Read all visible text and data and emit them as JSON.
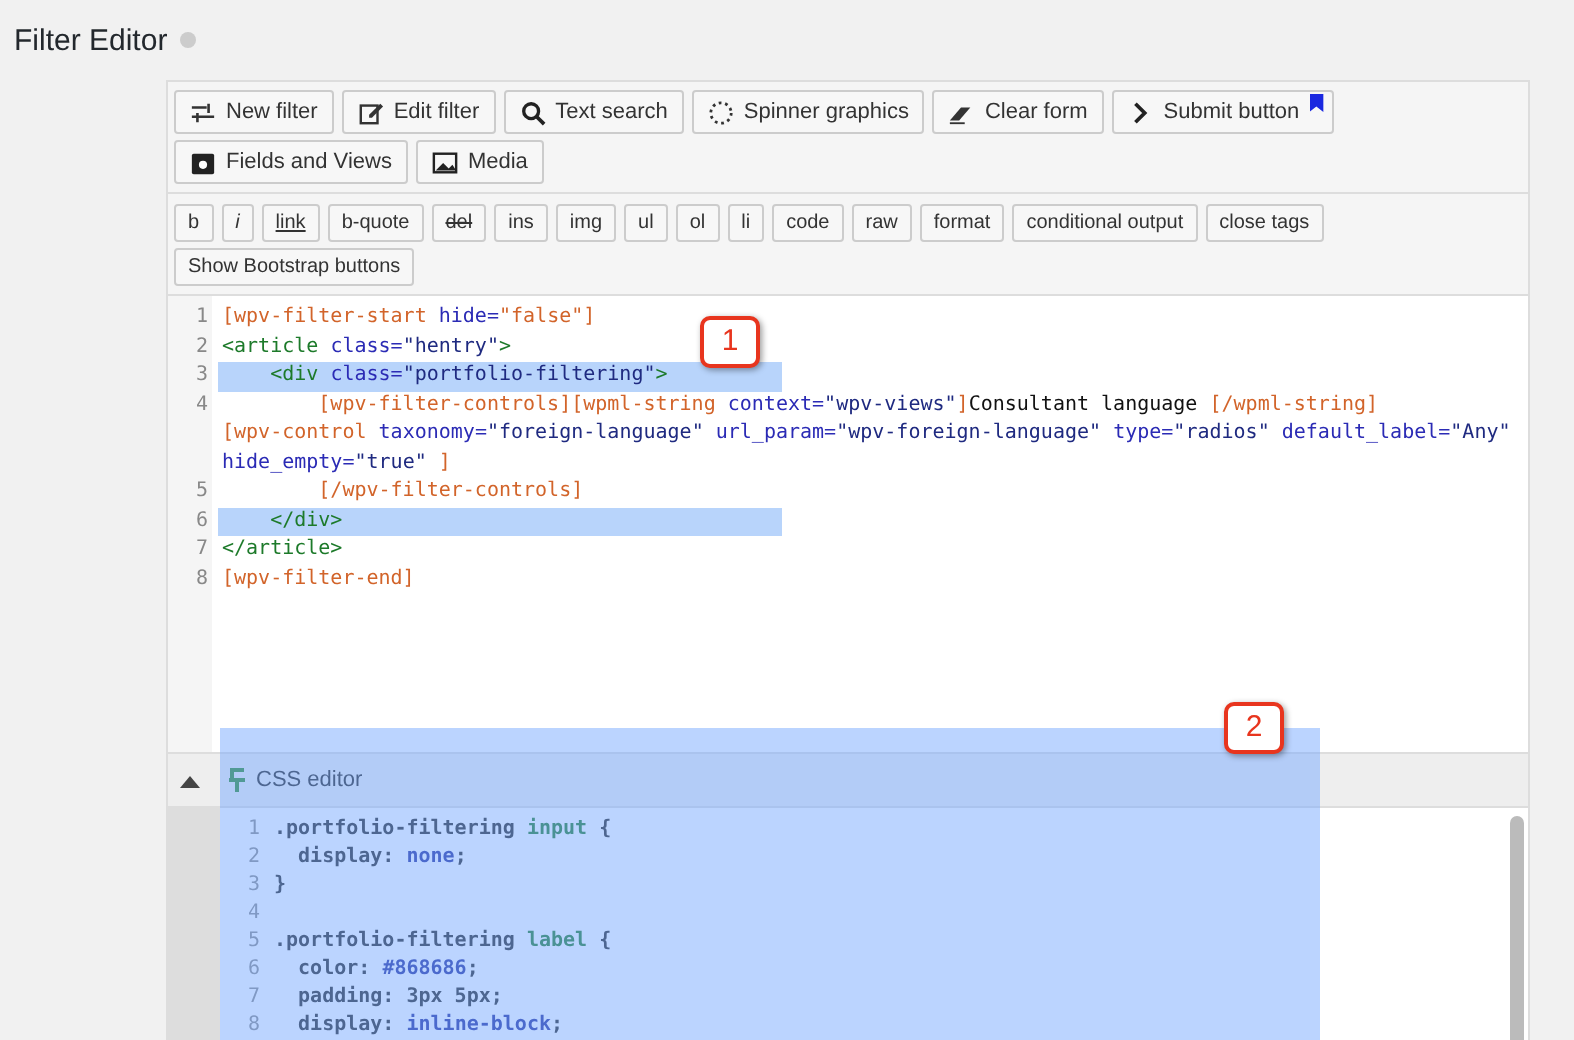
{
  "page_title": "Filter Editor",
  "toolbar_buttons": [
    {
      "label": "New filter",
      "flagged": false
    },
    {
      "label": "Edit filter",
      "flagged": false
    },
    {
      "label": "Text search",
      "flagged": false
    },
    {
      "label": "Spinner graphics",
      "flagged": false
    },
    {
      "label": "Clear form",
      "flagged": false
    },
    {
      "label": "Submit button",
      "flagged": true
    },
    {
      "label": "Fields and Views",
      "flagged": false
    },
    {
      "label": "Media",
      "flagged": false
    }
  ],
  "format_buttons": [
    "b",
    "i",
    "link",
    "b-quote",
    "del",
    "ins",
    "img",
    "ul",
    "ol",
    "li",
    "code",
    "raw",
    "format",
    "conditional output",
    "close tags",
    "Show Bootstrap buttons"
  ],
  "code_editor": {
    "lines": [
      {
        "number": "1",
        "selected": false,
        "rows": [
          {
            "tokens": [
              {
                "kind": "shortcode",
                "text": "[wpv-filter-start "
              },
              {
                "kind": "attr",
                "text": "hide="
              },
              {
                "kind": "shortcode",
                "text": "\"false\"]"
              }
            ]
          }
        ]
      },
      {
        "number": "2",
        "selected": false,
        "rows": [
          {
            "tokens": [
              {
                "kind": "tag",
                "text": "<article "
              },
              {
                "kind": "attr",
                "text": "class="
              },
              {
                "kind": "string",
                "text": "\"hentry\""
              },
              {
                "kind": "tag",
                "text": ">"
              }
            ]
          }
        ]
      },
      {
        "number": "3",
        "selected": true,
        "rows": [
          {
            "tokens": [
              {
                "kind": "tag",
                "text": "    <div "
              },
              {
                "kind": "attr",
                "text": "class="
              },
              {
                "kind": "string",
                "text": "\"portfolio-filtering\""
              },
              {
                "kind": "tag",
                "text": ">"
              }
            ]
          }
        ]
      },
      {
        "number": "4",
        "selected": false,
        "rows": [
          {
            "tokens": [
              {
                "kind": "shortcode",
                "text": "        [wpv-filter-controls][wpml-string "
              },
              {
                "kind": "attr",
                "text": "context="
              },
              {
                "kind": "string",
                "text": "\"wpv-views\""
              },
              {
                "kind": "shortcode",
                "text": "]"
              },
              {
                "kind": "text",
                "text": "Consultant language "
              },
              {
                "kind": "shortcode",
                "text": "[/wpml-string]"
              }
            ]
          },
          {
            "tokens": [
              {
                "kind": "shortcode",
                "text": "[wpv-control "
              },
              {
                "kind": "attr",
                "text": "taxonomy="
              },
              {
                "kind": "string",
                "text": "\"foreign-language\" "
              },
              {
                "kind": "attr",
                "text": "url_param="
              },
              {
                "kind": "string",
                "text": "\"wpv-foreign-language\" "
              },
              {
                "kind": "attr",
                "text": "type="
              },
              {
                "kind": "string",
                "text": "\"radios\" "
              },
              {
                "kind": "attr",
                "text": "default_label="
              },
              {
                "kind": "string",
                "text": "\"Any\""
              }
            ]
          },
          {
            "tokens": [
              {
                "kind": "attr",
                "text": "hide_empty="
              },
              {
                "kind": "string",
                "text": "\"true\" "
              },
              {
                "kind": "shortcode",
                "text": "]"
              }
            ]
          }
        ]
      },
      {
        "number": "5",
        "selected": false,
        "rows": [
          {
            "tokens": [
              {
                "kind": "shortcode",
                "text": "        [/wpv-filter-controls]"
              }
            ]
          }
        ]
      },
      {
        "number": "6",
        "selected": true,
        "rows": [
          {
            "tokens": [
              {
                "kind": "tag",
                "text": "    </div>"
              }
            ]
          }
        ]
      },
      {
        "number": "7",
        "selected": false,
        "rows": [
          {
            "tokens": [
              {
                "kind": "tag",
                "text": "</article>"
              }
            ]
          }
        ]
      },
      {
        "number": "8",
        "selected": false,
        "rows": [
          {
            "tokens": [
              {
                "kind": "shortcode",
                "text": "[wpv-filter-end]"
              }
            ]
          }
        ]
      }
    ]
  },
  "callouts": [
    "1",
    "2"
  ],
  "css_editor": {
    "title": "CSS editor",
    "expanded": true,
    "lines": [
      {
        "number": "1",
        "rows": [
          {
            "tokens": [
              {
                "kind": "selector",
                "text": ".portfolio-filtering "
              },
              {
                "kind": "tag",
                "text": "input"
              },
              {
                "kind": "selector",
                "text": " {"
              }
            ]
          }
        ]
      },
      {
        "number": "2",
        "rows": [
          {
            "tokens": [
              {
                "kind": "selector",
                "text": "  display: "
              },
              {
                "kind": "value",
                "text": "none"
              },
              {
                "kind": "selector",
                "text": ";"
              }
            ]
          }
        ]
      },
      {
        "number": "3",
        "rows": [
          {
            "tokens": [
              {
                "kind": "selector",
                "text": "}"
              }
            ]
          }
        ]
      },
      {
        "number": "4"
      },
      {
        "number": "5",
        "rows": [
          {
            "tokens": [
              {
                "kind": "selector",
                "text": ".portfolio-filtering "
              },
              {
                "kind": "tag",
                "text": "label"
              },
              {
                "kind": "selector",
                "text": " {"
              }
            ]
          }
        ]
      },
      {
        "number": "6",
        "rows": [
          {
            "tokens": [
              {
                "kind": "selector",
                "text": "  color: "
              },
              {
                "kind": "value",
                "text": "#868686"
              },
              {
                "kind": "selector",
                "text": ";"
              }
            ]
          }
        ]
      },
      {
        "number": "7",
        "rows": [
          {
            "tokens": [
              {
                "kind": "selector",
                "text": "  padding: 3px 5px;"
              }
            ]
          }
        ]
      },
      {
        "number": "8",
        "rows": [
          {
            "tokens": [
              {
                "kind": "selector",
                "text": "  display: "
              },
              {
                "kind": "value",
                "text": "inline-block"
              },
              {
                "kind": "selector",
                "text": ";"
              }
            ]
          }
        ]
      }
    ]
  }
}
